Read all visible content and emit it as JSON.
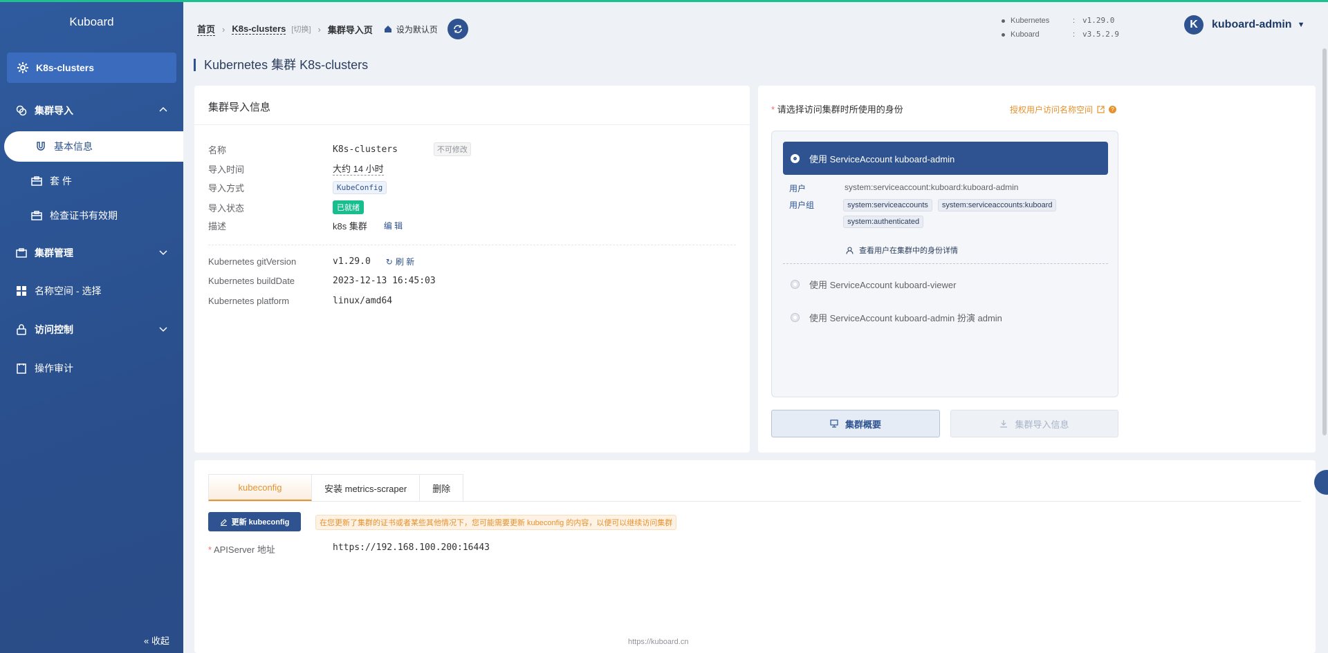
{
  "sidebar": {
    "brand": "Kuboard",
    "active_top": "K8s-clusters",
    "group_import": "集群导入",
    "item_basic": "基本信息",
    "item_suite": "套 件",
    "item_cert": "检查证书有效期",
    "group_manage": "集群管理",
    "item_namespace": "名称空间 - 选择",
    "group_access": "访问控制",
    "item_audit": "操作审计",
    "collapse": "收起"
  },
  "header": {
    "crumb_home": "首页",
    "crumb_cluster": "K8s-clusters",
    "crumb_switch": "[切换]",
    "crumb_current": "集群导入页",
    "set_default": "设为默认页",
    "versions": [
      {
        "name": "Kubernetes",
        "sep": ":",
        "value": "v1.29.0"
      },
      {
        "name": "Kuboard",
        "sep": ":",
        "value": "v3.5.2.9"
      }
    ],
    "avatar_letter": "K",
    "username": "kuboard-admin"
  },
  "page_title": "Kubernetes 集群 K8s-clusters",
  "info_card": {
    "title": "集群导入信息",
    "name_label": "名称",
    "name_value": "K8s-clusters",
    "name_tag": "不可修改",
    "time_label": "导入时间",
    "time_value": "大约 14 小时",
    "method_label": "导入方式",
    "method_value": "KubeConfig",
    "status_label": "导入状态",
    "status_value": "已就绪",
    "desc_label": "描述",
    "desc_value": "k8s 集群",
    "desc_edit": "编 辑",
    "git_label": "Kubernetes gitVersion",
    "git_value": "v1.29.0",
    "refresh": "刷 新",
    "build_label": "Kubernetes buildDate",
    "build_value": "2023-12-13 16:45:03",
    "platform_label": "Kubernetes platform",
    "platform_value": "linux/amd64"
  },
  "identity_card": {
    "required_star": "*",
    "prompt": "请选择访问集群时所使用的身份",
    "auth_link": "授权用户访问名称空间",
    "selected_option": "使用 ServiceAccount kuboard-admin",
    "user_label": "用户",
    "user_value": "system:serviceaccount:kuboard:kuboard-admin",
    "groups_label": "用户组",
    "groups": [
      "system:serviceaccounts",
      "system:serviceaccounts:kuboard",
      "system:authenticated"
    ],
    "detail_link": "查看用户在集群中的身份详情",
    "option_viewer": "使用 ServiceAccount kuboard-viewer",
    "option_impersonate": "使用 ServiceAccount kuboard-admin 扮演 admin",
    "btn_overview": "集群概要",
    "btn_import_info": "集群导入信息"
  },
  "bottom_card": {
    "tabs": [
      "kubeconfig",
      "安装 metrics-scraper",
      "删除"
    ],
    "update_btn": "更新 kubeconfig",
    "warning": "在您更新了集群的证书或者某些其他情况下，您可能需要更新 kubeconfig 的内容，以便可以继续访问集群",
    "api_star": "*",
    "api_label": "APIServer 地址",
    "api_value": "https://192.168.100.200:16443"
  },
  "footer": "https://kuboard.cn",
  "colors": {
    "primary": "#2e5390",
    "accent": "#e6922e",
    "success": "#19be8f",
    "topline": "#1fc08f"
  },
  "icons": [
    "gear-icon",
    "link-icon",
    "magnet-icon",
    "box-icon",
    "grid-icon",
    "lock-icon",
    "audit-icon",
    "home-icon",
    "refresh-icon",
    "user-icon",
    "external-link-icon",
    "help-icon",
    "monitor-icon",
    "download-icon",
    "edit-icon",
    "chevron-up-icon",
    "chevron-down-icon",
    "caret-down-icon",
    "double-chevron-left-icon"
  ]
}
